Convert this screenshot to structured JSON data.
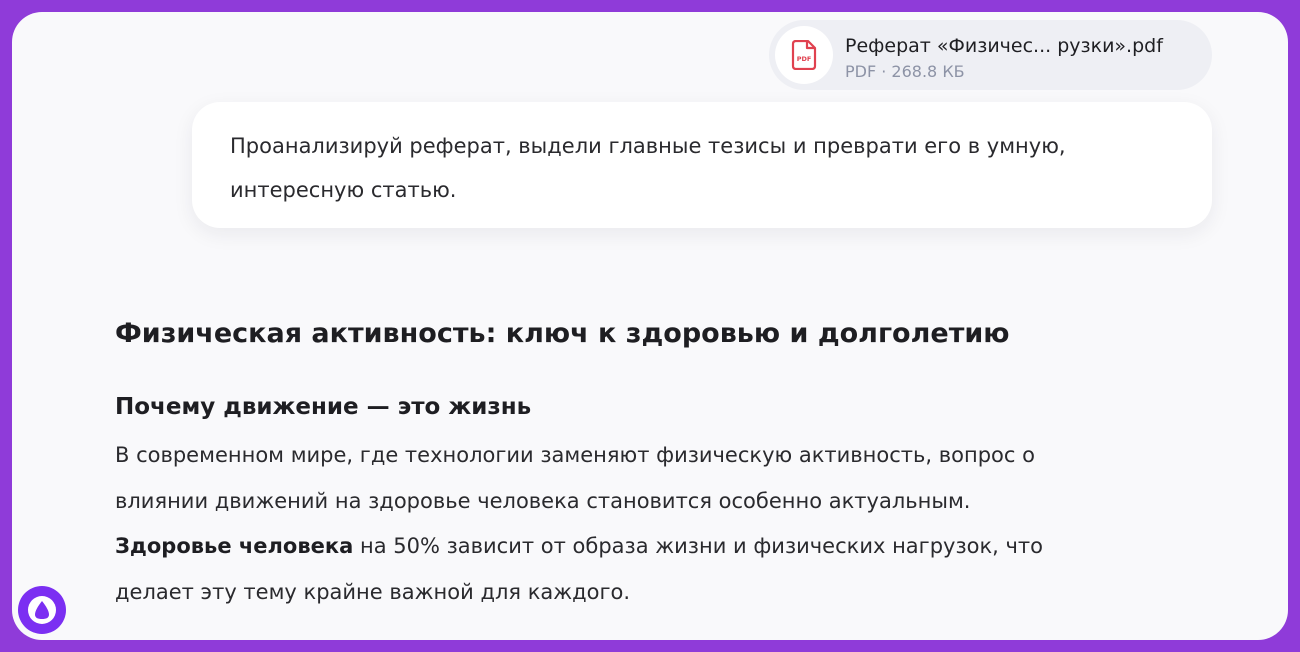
{
  "attachment": {
    "icon": "pdf-file-icon",
    "name": "Реферат «Физичес... рузки».pdf",
    "meta": "PDF · 268.8 КБ"
  },
  "user_message": {
    "text": "Проанализируй реферат, выдели главные тезисы и преврати его в умную, интересную статью."
  },
  "answer": {
    "title": "Физическая активность: ключ к здоровью и долголетию",
    "section_title": "Почему движение — это жизнь",
    "paragraph_part1": "В современном мире, где технологии заменяют физическую активность, вопрос о влиянии движений на здоровье человека становится особенно актуальным.",
    "paragraph_bold": "Здоровье человека",
    "paragraph_part2": " на 50% зависит от образа жизни и физических нагрузок, что делает эту тему крайне важной для каждого."
  },
  "assistant_logo": {
    "icon": "alice-logo-icon"
  },
  "colors": {
    "frame": "#8f3bd9",
    "background": "#f9f9fb",
    "pdf_red": "#e0414f",
    "logo_purple": "#7b2ff2"
  }
}
